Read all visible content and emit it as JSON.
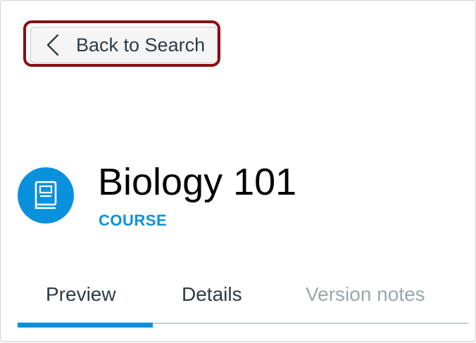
{
  "back_button": {
    "label": "Back to Search"
  },
  "course": {
    "title": "Biology 101",
    "type": "COURSE",
    "icon": "book-icon"
  },
  "tabs": [
    {
      "label": "Preview",
      "active": true
    },
    {
      "label": "Details",
      "active": false
    },
    {
      "label": "Version notes",
      "active": false
    }
  ],
  "colors": {
    "accent": "#0a91dd",
    "highlight": "#8b0e13",
    "text": "#2d3b45",
    "muted": "#9ba6ad"
  }
}
